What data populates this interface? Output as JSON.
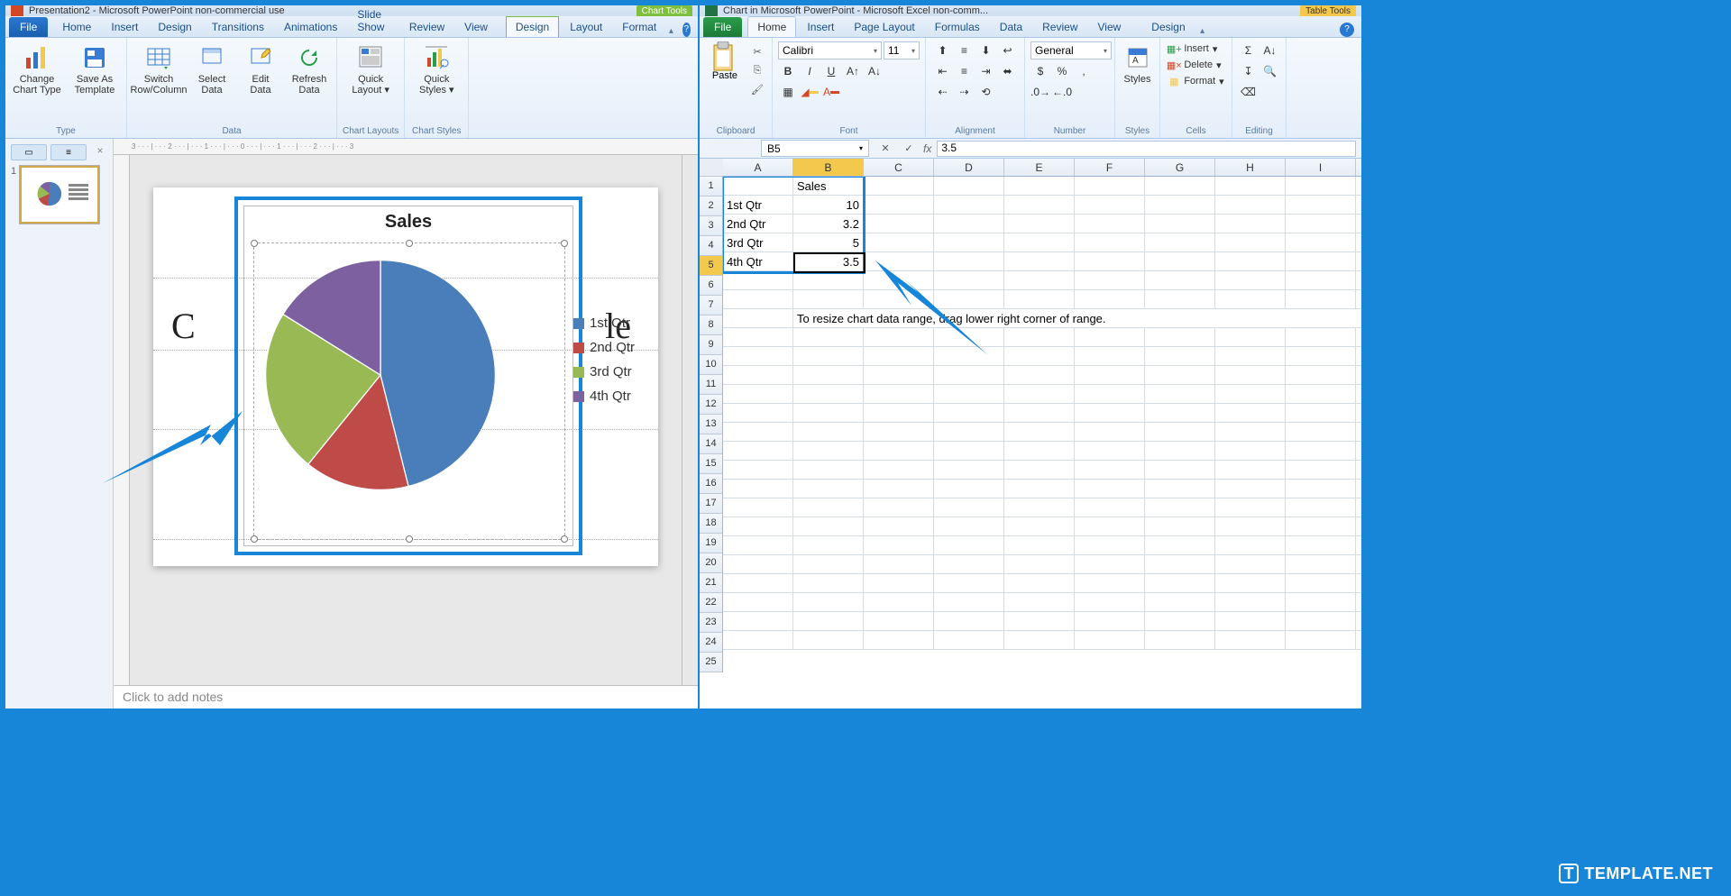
{
  "powerpoint": {
    "title": "Presentation2 - Microsoft PowerPoint non-commercial use",
    "chart_tools_label": "Chart Tools",
    "file_tab": "File",
    "tabs": [
      "Home",
      "Insert",
      "Design",
      "Transitions",
      "Animations",
      "Slide Show",
      "Review",
      "View"
    ],
    "chart_tabs": [
      "Design",
      "Layout",
      "Format"
    ],
    "ribbon": {
      "type_group": "Type",
      "change_chart_type": "Change Chart Type",
      "save_as_template": "Save As Template",
      "data_group": "Data",
      "switch_row_col": "Switch Row/Column",
      "select_data": "Select Data",
      "edit_data": "Edit Data",
      "refresh_data": "Refresh Data",
      "chart_layouts_group": "Chart Layouts",
      "quick_layout": "Quick Layout ▾",
      "chart_styles_group": "Chart Styles",
      "quick_styles": "Quick Styles ▾"
    },
    "slide_number": "1",
    "chart_title": "Sales",
    "bg_text_left": "C",
    "bg_text_right": "le",
    "legend": [
      "1st Qtr",
      "2nd Qtr",
      "3rd Qtr",
      "4th Qtr"
    ],
    "notes_placeholder": "Click to add notes",
    "ruler_marks": "3 · · · | · · · 2 · · · | · · · 1 · · · | · · · 0 · · · | · · · 1 · · · | · · · 2 · · · | · · · 3"
  },
  "excel": {
    "title": "Chart in Microsoft PowerPoint - Microsoft Excel non-comm...",
    "table_tools_label": "Table Tools",
    "file_tab": "File",
    "tabs": [
      "Home",
      "Insert",
      "Page Layout",
      "Formulas",
      "Data",
      "Review",
      "View"
    ],
    "design_tab": "Design",
    "ribbon": {
      "clipboard_group": "Clipboard",
      "paste": "Paste",
      "font_group": "Font",
      "font_name": "Calibri",
      "font_size": "11",
      "alignment_group": "Alignment",
      "number_group": "Number",
      "number_format": "General",
      "styles_group": "Styles",
      "styles_btn": "Styles",
      "cells_group": "Cells",
      "insert_btn": "Insert",
      "delete_btn": "Delete",
      "format_btn": "Format",
      "editing_group": "Editing"
    },
    "name_box": "B5",
    "formula_value": "3.5",
    "columns": [
      "A",
      "B",
      "C",
      "D",
      "E",
      "F",
      "G",
      "H",
      "I"
    ],
    "rows_visible": 25,
    "hint_row": 8,
    "hint_text": "To resize chart data range, drag lower right corner of range.",
    "data": {
      "header": [
        "",
        "Sales"
      ],
      "rows": [
        [
          "1st Qtr",
          "10"
        ],
        [
          "2nd Qtr",
          "3.2"
        ],
        [
          "3rd Qtr",
          "5"
        ],
        [
          "4th Qtr",
          "3.5"
        ]
      ]
    },
    "active_cell": {
      "row": 5,
      "col": "B"
    }
  },
  "chart_data": {
    "type": "pie",
    "title": "Sales",
    "categories": [
      "1st Qtr",
      "2nd Qtr",
      "3rd Qtr",
      "4th Qtr"
    ],
    "values": [
      10,
      3.2,
      5,
      3.5
    ],
    "colors": [
      "#4a7ebb",
      "#be4b48",
      "#98b954",
      "#7d60a0"
    ],
    "legend_position": "right"
  },
  "watermark": "TEMPLATE.NET"
}
